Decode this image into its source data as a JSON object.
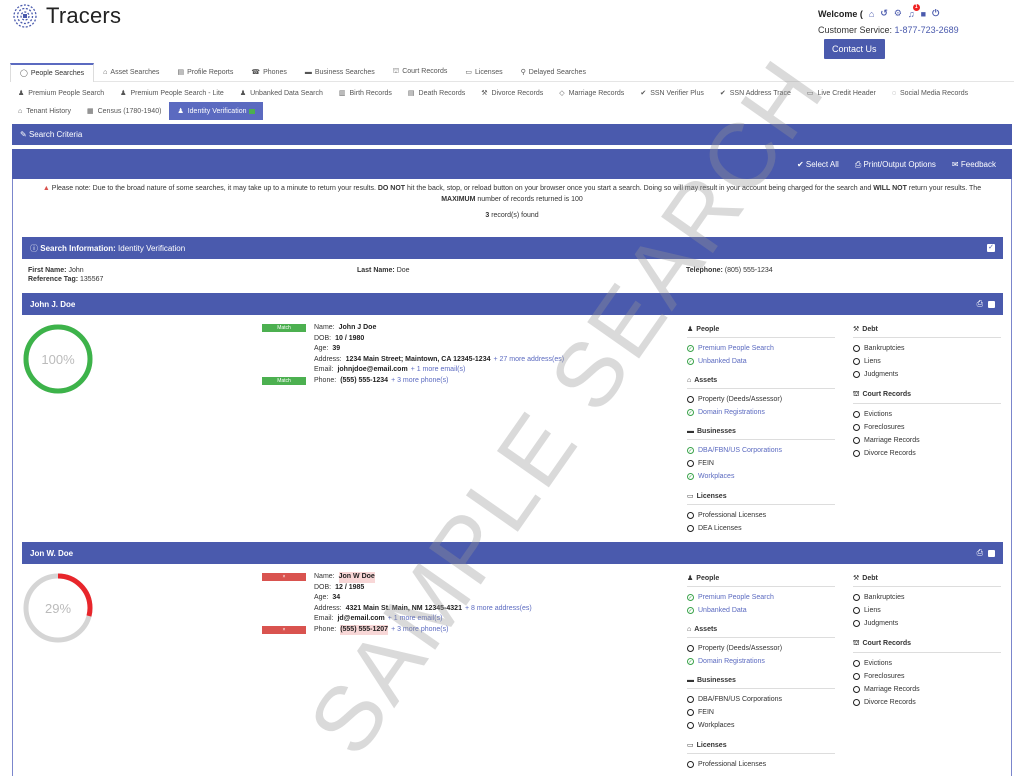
{
  "header": {
    "logo_text": "Tracers",
    "welcome": "Welcome (",
    "icons": [
      "home-icon",
      "history-icon",
      "settings-icon",
      "bell-icon",
      "lock-icon",
      "power-icon"
    ],
    "notification_count": "1",
    "customer_service_label": "Customer Service:",
    "customer_service_phone": "1-877-723-2689",
    "contact_button": "Contact Us"
  },
  "main_tabs": [
    {
      "label": "People Searches",
      "icon": "person-icon",
      "active": true
    },
    {
      "label": "Asset Searches",
      "icon": "home-icon"
    },
    {
      "label": "Profile Reports",
      "icon": "file-icon"
    },
    {
      "label": "Phones",
      "icon": "phone-icon"
    },
    {
      "label": "Business Searches",
      "icon": "briefcase-icon"
    },
    {
      "label": "Court Records",
      "icon": "courthouse-icon"
    },
    {
      "label": "Licenses",
      "icon": "id-card-icon"
    },
    {
      "label": "Delayed Searches",
      "icon": "search-icon"
    }
  ],
  "sub_tabs": [
    {
      "label": "Premium People Search",
      "icon": "user-icon"
    },
    {
      "label": "Premium People Search - Lite",
      "icon": "user-icon"
    },
    {
      "label": "Unbanked Data Search",
      "icon": "user-icon"
    },
    {
      "label": "Birth Records",
      "icon": "building-icon"
    },
    {
      "label": "Death Records",
      "icon": "file-icon"
    },
    {
      "label": "Divorce Records",
      "icon": "gavel-icon"
    },
    {
      "label": "Marriage Records",
      "icon": "diamond-icon"
    },
    {
      "label": "SSN Verifier Plus",
      "icon": "check-icon"
    },
    {
      "label": "SSN Address Trace",
      "icon": "check-icon"
    },
    {
      "label": "Live Credit Header",
      "icon": "credit-card-icon"
    },
    {
      "label": "Social Media Records",
      "icon": "chat-icon"
    },
    {
      "label": "Tenant History",
      "icon": "home-icon"
    },
    {
      "label": "Census (1780-1940)",
      "icon": "table-icon"
    },
    {
      "label": "Identity Verification",
      "icon": "user-icon",
      "active": true
    }
  ],
  "search_criteria": {
    "label": "Search Criteria"
  },
  "actions": {
    "select_all": "Select All",
    "print": "Print/Output Options",
    "feedback": "Feedback"
  },
  "notice": {
    "part1": "Please note: Due to the broad nature of some searches, it may take up to a minute to return your results.",
    "bold1": "DO NOT",
    "part2": "hit the back, stop, or reload button on your browser once you start a search. Doing so will may result in your account being charged for the search and",
    "bold2": "WILL NOT",
    "part3": "return your results. The",
    "bold3": "MAXIMUM",
    "part4": "number of records returned is 100"
  },
  "records_found": {
    "count": "3",
    "label": "record(s) found"
  },
  "search_info": {
    "title_bold": "Search Information:",
    "title": "Identity Verification",
    "first_name_label": "First Name:",
    "first_name": "John",
    "last_name_label": "Last Name:",
    "last_name": "Doe",
    "telephone_label": "Telephone:",
    "telephone": "(805) 555-1234",
    "ref_tag_label": "Reference Tag:",
    "ref_tag": "135567"
  },
  "persons": [
    {
      "name": "John J. Doe",
      "score_text": "100%",
      "score": 100,
      "score_color": "#3db34a",
      "details": {
        "name_match": "Match",
        "name": "John  J  Doe",
        "dob": "10 / 1980",
        "age": "39",
        "address": "1234 Main Street; Maintown, CA 12345-1234",
        "address_more": "+ 27 more address(es)",
        "email": "johnjdoe@email.com",
        "email_more": "+ 1 more email(s)",
        "phone_match": "Match",
        "phone": "(555) 555-1234",
        "phone_more": "+ 3 more phone(s)"
      },
      "people": [
        {
          "label": "Premium People Search",
          "on": true
        },
        {
          "label": "Unbanked Data",
          "on": true
        }
      ],
      "assets": [
        {
          "label": "Property (Deeds/Assessor)",
          "on": false
        },
        {
          "label": "Domain Registrations",
          "on": true
        }
      ],
      "businesses": [
        {
          "label": "DBA/FBN/US Corporations",
          "on": true
        },
        {
          "label": "FEIN",
          "on": false
        },
        {
          "label": "Workplaces",
          "on": true
        }
      ],
      "licenses": [
        {
          "label": "Professional Licenses",
          "on": false
        },
        {
          "label": "DEA Licenses",
          "on": false
        }
      ],
      "debt": [
        {
          "label": "Bankruptcies",
          "on": false
        },
        {
          "label": "Liens",
          "on": false
        },
        {
          "label": "Judgments",
          "on": false
        }
      ],
      "court": [
        {
          "label": "Evictions",
          "on": false
        },
        {
          "label": "Foreclosures",
          "on": false
        },
        {
          "label": "Marriage Records",
          "on": false
        },
        {
          "label": "Divorce Records",
          "on": false
        }
      ]
    },
    {
      "name": "Jon W. Doe",
      "score_text": "29%",
      "score": 29,
      "score_color": "#e8262b",
      "details": {
        "name_match": "×",
        "name": "Jon  W  Doe",
        "dob": "12 / 1985",
        "age": "34",
        "address": "4321 Main St. Main, NM 12345-4321",
        "address_more": "+ 8 more address(es)",
        "email": "jd@email.com",
        "email_more": "+ 1 more email(s)",
        "phone_match": "×",
        "phone": "(555) 555-1207",
        "phone_more": "+ 3 more phone(s)"
      },
      "people": [
        {
          "label": "Premium People Search",
          "on": true
        },
        {
          "label": "Unbanked Data",
          "on": true
        }
      ],
      "assets": [
        {
          "label": "Property (Deeds/Assessor)",
          "on": false
        },
        {
          "label": "Domain Registrations",
          "on": true
        }
      ],
      "businesses": [
        {
          "label": "DBA/FBN/US Corporations",
          "on": false
        },
        {
          "label": "FEIN",
          "on": false
        },
        {
          "label": "Workplaces",
          "on": false
        }
      ],
      "licenses": [
        {
          "label": "Professional Licenses",
          "on": false
        }
      ],
      "debt": [
        {
          "label": "Bankruptcies",
          "on": false
        },
        {
          "label": "Liens",
          "on": false
        },
        {
          "label": "Judgments",
          "on": false
        }
      ],
      "court": [
        {
          "label": "Evictions",
          "on": false
        },
        {
          "label": "Foreclosures",
          "on": false
        },
        {
          "label": "Marriage Records",
          "on": false
        },
        {
          "label": "Divorce Records",
          "on": false
        }
      ]
    }
  ],
  "category_labels": {
    "people": "People",
    "assets": "Assets",
    "businesses": "Businesses",
    "licenses": "Licenses",
    "debt": "Debt",
    "court": "Court Records"
  },
  "field_labels": {
    "name": "Name:",
    "dob": "DOB:",
    "age": "Age:",
    "address": "Address:",
    "email": "Email:",
    "phone": "Phone:"
  },
  "watermark": "SAMPLE SEARCH"
}
